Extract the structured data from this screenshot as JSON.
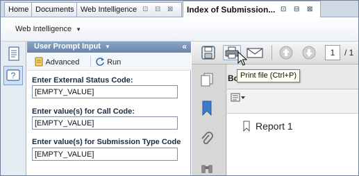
{
  "tabs": [
    {
      "label": "Home"
    },
    {
      "label": "Documents"
    },
    {
      "label": "Web Intelligence"
    },
    {
      "label": "Index of Submission..."
    }
  ],
  "menubar": {
    "app_label": "Web Intelligence",
    "caret": "▼"
  },
  "prompt_panel": {
    "title": "User Prompt Input",
    "caret": "▼",
    "collapse": "«",
    "tools": {
      "advanced": "Advanced",
      "run": "Run"
    },
    "prompts": [
      {
        "label": "Enter External Status Code:",
        "value": "[EMPTY_VALUE]"
      },
      {
        "label": "Enter value(s) for Call Code:",
        "value": "[EMPTY_VALUE]"
      },
      {
        "label": "Enter value(s) for Submission Type Code",
        "value": "[EMPTY_VALUE]"
      }
    ]
  },
  "viewer": {
    "page_current": "1",
    "page_total": "/ 1",
    "bookmarks_title": "Bo",
    "bookmark_items": [
      {
        "label": "Report 1"
      }
    ],
    "tooltip": "Print file (Ctrl+P)"
  },
  "colors": {
    "accent": "#6a86aa",
    "panel_header": "#8aa4c4",
    "tab_bg": "#cfd9e6"
  }
}
